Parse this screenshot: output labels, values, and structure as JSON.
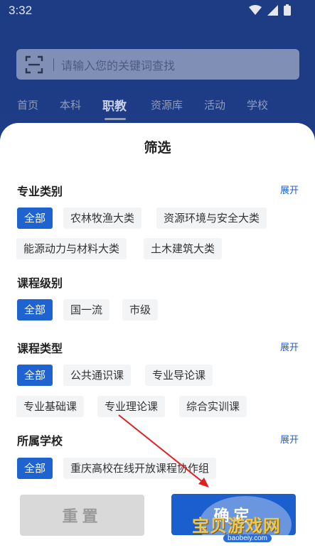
{
  "status_bar": {
    "time": "3:32"
  },
  "search": {
    "placeholder": "请输入您的关键词查找"
  },
  "nav_tabs": [
    {
      "label": "首页"
    },
    {
      "label": "本科"
    },
    {
      "label": "职教",
      "active": true
    },
    {
      "label": "资源库"
    },
    {
      "label": "活动"
    },
    {
      "label": "学校"
    }
  ],
  "sheet": {
    "title": "筛选",
    "expand_label": "展开",
    "sections": [
      {
        "title": "专业类别",
        "has_expand": true,
        "chips": [
          "全部",
          "农林牧渔大类",
          "资源环境与安全大类",
          "能源动力与材料大类",
          "土木建筑大类"
        ]
      },
      {
        "title": "课程级别",
        "has_expand": false,
        "chips": [
          "全部",
          "国一流",
          "市级"
        ]
      },
      {
        "title": "课程类型",
        "has_expand": true,
        "chips": [
          "全部",
          "公共通识课",
          "专业导论课",
          "专业基础课",
          "专业理论课",
          "综合实训课"
        ]
      },
      {
        "title": "所属学校",
        "has_expand": true,
        "chips": [
          "全部",
          "重庆高校在线开放课程协作组"
        ]
      }
    ],
    "reset_label": "重置",
    "confirm_label": "确定"
  },
  "watermark": {
    "text": "宝贝游戏网",
    "url": "baobeiy.com"
  },
  "colors": {
    "accent": "#1e63cf",
    "chip_bg": "#f3f4f6",
    "link": "#1e5fc9"
  }
}
